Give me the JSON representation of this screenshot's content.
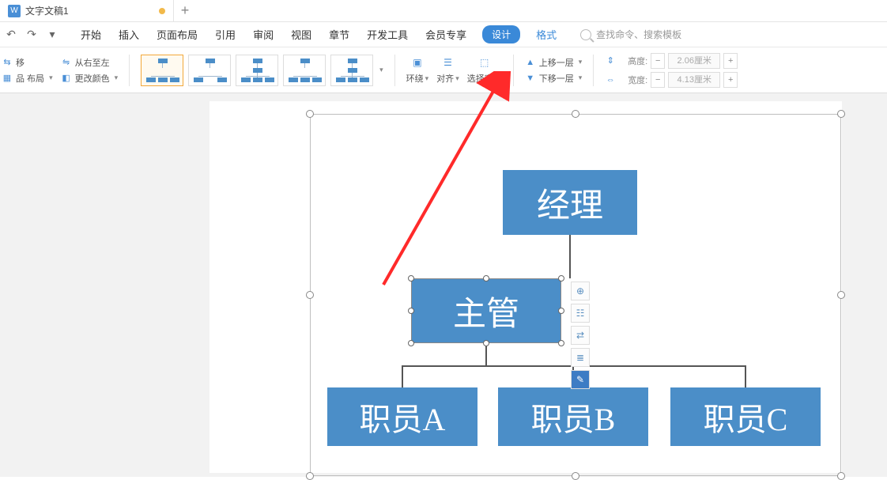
{
  "titlebar": {
    "doc_icon_letter": "W",
    "doc_title": "文字文稿1"
  },
  "menu": {
    "items": [
      "开始",
      "插入",
      "页面布局",
      "引用",
      "审阅",
      "视图",
      "章节",
      "开发工具",
      "会员专享"
    ],
    "design": "设计",
    "format": "格式",
    "search_placeholder": "查找命令、搜索模板"
  },
  "ribbon": {
    "left1_line1": "移",
    "left1_line2": "品 布局",
    "left2_line1": "从右至左",
    "left2_line2": "更改颜色",
    "wrap": "环绕",
    "align": "对齐",
    "selpane": "选择窗格",
    "moveup": "上移一层",
    "movedown": "下移一层",
    "height_label": "高度:",
    "height_value": "2.06厘米",
    "width_label": "宽度:",
    "width_value": "4.13厘米"
  },
  "chart_data": {
    "type": "org-hierarchy",
    "nodes": {
      "manager": "经理",
      "supervisor": "主管",
      "empA": "职员A",
      "empB": "职员B",
      "empC": "职员C"
    },
    "edges": [
      [
        "manager",
        "supervisor"
      ],
      [
        "supervisor",
        "empA"
      ],
      [
        "supervisor",
        "empB"
      ],
      [
        "supervisor",
        "empC"
      ]
    ],
    "selected_node": "supervisor",
    "node_fill": "#4b8ec8",
    "node_text_color": "#ffffff"
  }
}
